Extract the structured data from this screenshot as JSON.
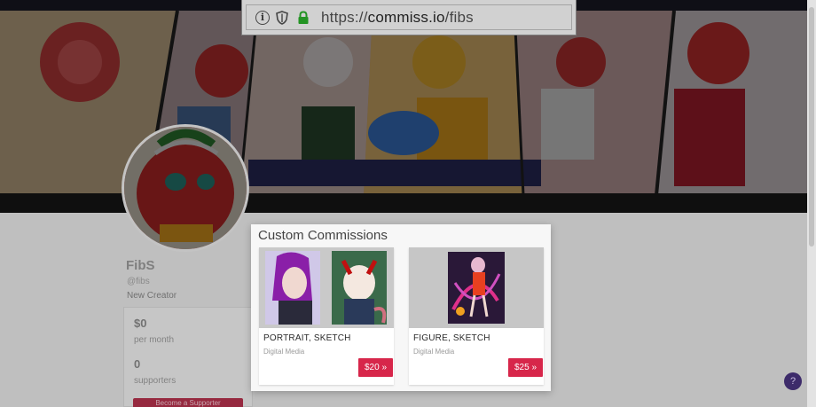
{
  "browser": {
    "url_scheme": "https://",
    "url_host": "commiss.io",
    "url_path": "/fibs",
    "icons": [
      "info-icon",
      "shield-icon",
      "lock-icon"
    ]
  },
  "profile": {
    "name": "FibS",
    "handle": "@fibs",
    "role": "New Creator",
    "stats": [
      {
        "value": "$0",
        "label": "per month"
      },
      {
        "value": "0",
        "label": "supporters"
      }
    ],
    "become_button": "Become a Supporter"
  },
  "modal": {
    "title": "Custom Commissions",
    "cards": [
      {
        "title": "PORTRAIT, SKETCH",
        "subtitle": "Digital Media",
        "price": "$20 »"
      },
      {
        "title": "FIGURE, SKETCH",
        "subtitle": "Digital Media",
        "price": "$25 »"
      }
    ]
  },
  "help_icon": "?",
  "colors": {
    "accent": "#d7264a",
    "lock": "#2db52d",
    "help": "#3d2b6a"
  }
}
